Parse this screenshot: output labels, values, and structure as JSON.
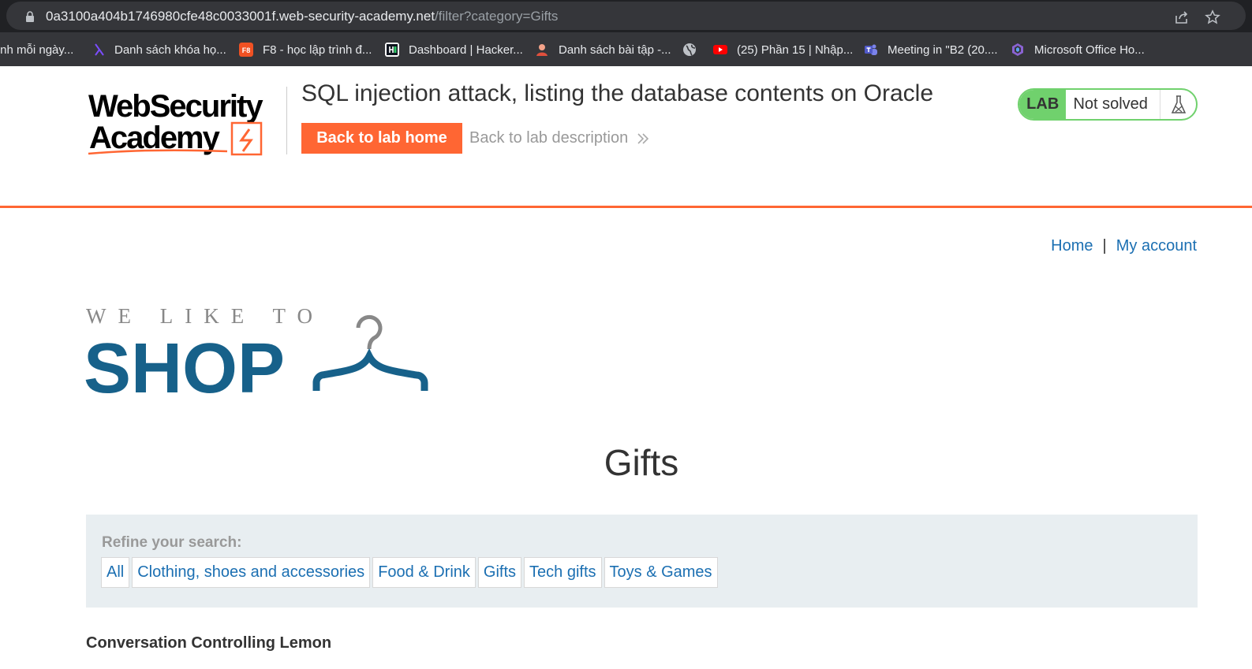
{
  "browser": {
    "url_main": "0a3100a404b1746980cfe48c0033001f.web-security-academy.net",
    "url_path": "/filter?category=Gifts",
    "bookmarks": [
      {
        "label": "ình mỗi ngày...",
        "icon": "none"
      },
      {
        "label": "Danh sách khóa họ...",
        "icon": "lambda-icon"
      },
      {
        "label": "F8 - học lập trình đ...",
        "icon": "f8-icon"
      },
      {
        "label": "Dashboard | Hacker...",
        "icon": "hackerrank-icon"
      },
      {
        "label": "Danh sách bài tập -...",
        "icon": "person-icon"
      },
      {
        "label": "",
        "icon": "globe-icon"
      },
      {
        "label": "(25) Phần 15 | Nhập...",
        "icon": "youtube-icon"
      },
      {
        "label": "Meeting in \"B2 (20....",
        "icon": "teams-icon"
      },
      {
        "label": "Microsoft Office Ho...",
        "icon": "office-icon"
      }
    ]
  },
  "lab": {
    "logo_line1": "WebSecurity",
    "logo_line2": "Academy",
    "title": "SQL injection attack, listing the database contents on Oracle",
    "back_home": "Back to lab home",
    "back_description": "Back to lab description",
    "badge_label": "LAB",
    "status": "Not solved"
  },
  "nav": {
    "home": "Home",
    "separator": "|",
    "account": "My account"
  },
  "shop_logo": {
    "line1": "WE LIKE TO",
    "line2": "SHOP"
  },
  "page": {
    "heading": "Gifts",
    "refine_label": "Refine your search:",
    "filters": [
      "All",
      "Clothing, shoes and accessories",
      "Food & Drink",
      "Gifts",
      "Tech gifts",
      "Toys & Games"
    ],
    "product": "Conversation Controlling Lemon"
  },
  "colors": {
    "accent": "#ff6633",
    "link": "#1b6fb2",
    "lab_green": "#70d16d",
    "shop_blue": "#17618a"
  }
}
